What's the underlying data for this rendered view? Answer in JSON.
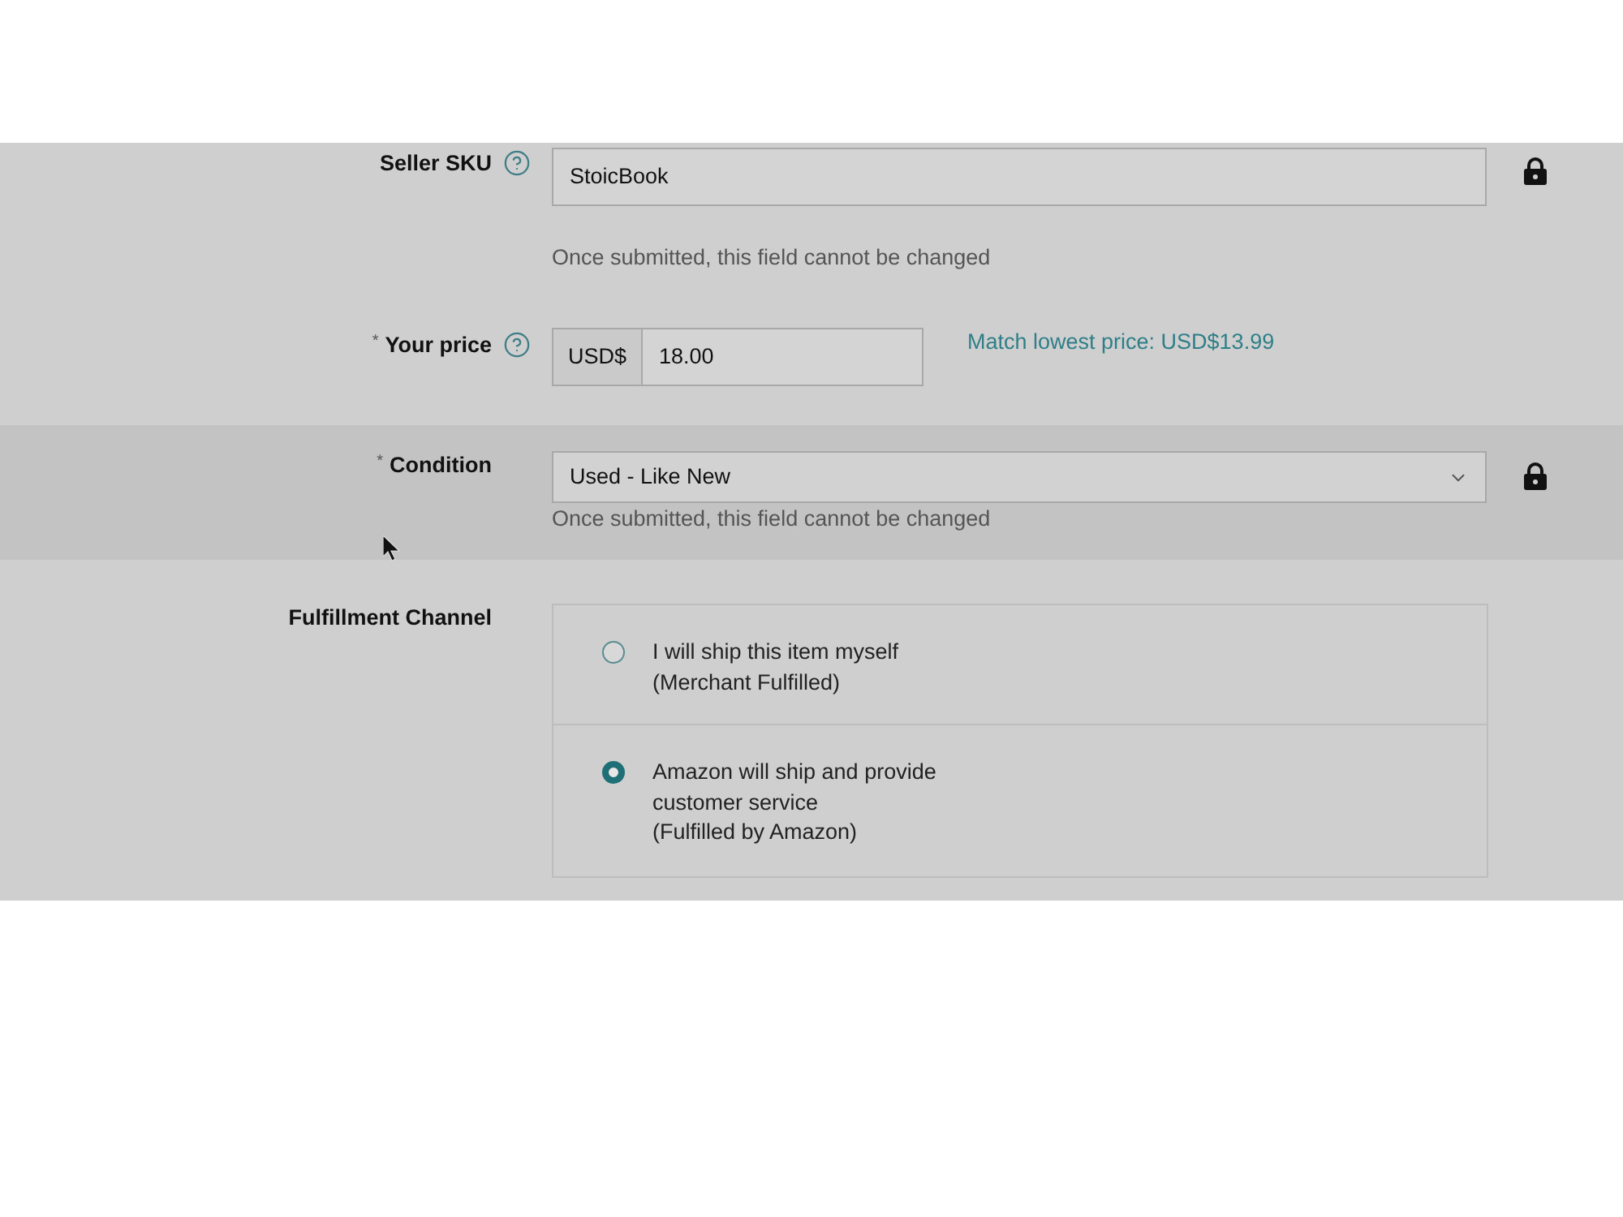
{
  "fields": [
    {
      "kind": "text",
      "label": "Seller SKU",
      "help": true,
      "value": "StoicBook",
      "locked": true,
      "note": "Once submitted, this field cannot be changed",
      "highlighted": false
    },
    {
      "kind": "price",
      "required_mark": "*",
      "label": "Your price",
      "help": true,
      "currency": "USD$",
      "value": "18.00",
      "link": "Match lowest price: USD$13.99",
      "highlighted": false
    },
    {
      "kind": "select",
      "required_mark": "*",
      "label": "Condition",
      "value": "Used - Like New",
      "locked": true,
      "note": "Once submitted, this field cannot be changed",
      "highlighted": true
    },
    {
      "kind": "radio",
      "label": "Fulfillment Channel",
      "highlighted": false,
      "options": [
        {
          "label_lines": [
            "I will ship this item myself",
            "(Merchant Fulfilled)"
          ],
          "selected": false
        },
        {
          "label_lines": [
            "Amazon will ship and provide",
            "customer service",
            "(Fulfilled by Amazon)"
          ],
          "selected": true
        }
      ]
    }
  ]
}
